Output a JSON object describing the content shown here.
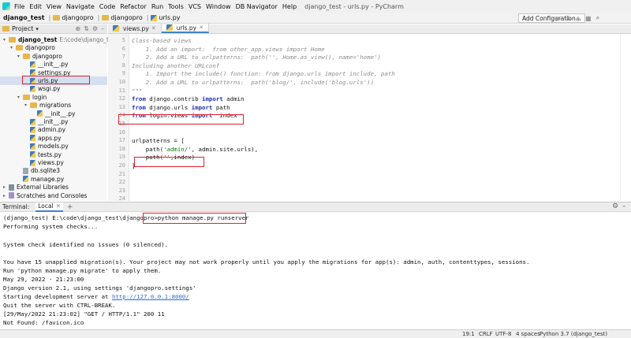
{
  "menu": {
    "items": [
      "File",
      "Edit",
      "View",
      "Navigate",
      "Code",
      "Refactor",
      "Run",
      "Tools",
      "VCS",
      "Window",
      "DB Navigator",
      "Help"
    ],
    "window_title": "django_test - urls.py - PyCharm"
  },
  "breadcrumb": {
    "root": "django_test",
    "folder": "djangopro",
    "file": "urls.py"
  },
  "toolbar": {
    "add_config_label": "Add Configuration...",
    "icons": [
      "run-icon",
      "debug-icon",
      "coverage-icon",
      "stop-icon",
      "search-icon"
    ]
  },
  "project_panel": {
    "title": "Project",
    "tree": [
      {
        "label": "django_test",
        "path": "E:\\code\\django_test",
        "depth": 0,
        "kind": "folder",
        "arrow": "▾",
        "bold": true
      },
      {
        "label": "djangopro",
        "depth": 1,
        "kind": "folder",
        "arrow": "▾"
      },
      {
        "label": "djangopro",
        "depth": 2,
        "kind": "folder",
        "arrow": "▾"
      },
      {
        "label": "__init__.py",
        "depth": 3,
        "kind": "py"
      },
      {
        "label": "settings.py",
        "depth": 3,
        "kind": "py"
      },
      {
        "label": "urls.py",
        "depth": 3,
        "kind": "py",
        "selected": true
      },
      {
        "label": "wsgi.py",
        "depth": 3,
        "kind": "py"
      },
      {
        "label": "login",
        "depth": 2,
        "kind": "folder",
        "arrow": "▾"
      },
      {
        "label": "migrations",
        "depth": 3,
        "kind": "folder",
        "arrow": "▾"
      },
      {
        "label": "__init__.py",
        "depth": 4,
        "kind": "py"
      },
      {
        "label": "__init__.py",
        "depth": 3,
        "kind": "py"
      },
      {
        "label": "admin.py",
        "depth": 3,
        "kind": "py"
      },
      {
        "label": "apps.py",
        "depth": 3,
        "kind": "py"
      },
      {
        "label": "models.py",
        "depth": 3,
        "kind": "py"
      },
      {
        "label": "tests.py",
        "depth": 3,
        "kind": "py"
      },
      {
        "label": "views.py",
        "depth": 3,
        "kind": "py"
      },
      {
        "label": "db.sqlite3",
        "depth": 2,
        "kind": "db"
      },
      {
        "label": "manage.py",
        "depth": 2,
        "kind": "py"
      },
      {
        "label": "External Libraries",
        "depth": 0,
        "kind": "lib",
        "arrow": "▸"
      },
      {
        "label": "Scratches and Consoles",
        "depth": 0,
        "kind": "scr",
        "arrow": "▸"
      }
    ]
  },
  "editor": {
    "tabs": [
      {
        "label": "views.py",
        "active": false
      },
      {
        "label": "urls.py",
        "active": true
      }
    ],
    "line_numbers": [
      "5",
      "6",
      "7",
      "8",
      "9",
      "10",
      "11",
      "12",
      "13",
      "14",
      "15",
      "16",
      "17",
      "18",
      "19",
      "20",
      "21",
      "22",
      "23",
      "24"
    ],
    "lines": [
      {
        "text": "Class-based views",
        "style": "comment"
      },
      {
        "text": "    1. Add an import:  from other_app.views import Home",
        "style": "comment"
      },
      {
        "text": "    2. Add a URL to urlpatterns:  path('', Home.as_view(), name='home')",
        "style": "comment"
      },
      {
        "text": "Including another URLconf",
        "style": "comment"
      },
      {
        "text": "    1. Import the include() function: from django.urls import include, path",
        "style": "comment"
      },
      {
        "text": "    2. Add a URL to urlpatterns:  path('blog/', include('blog.urls'))",
        "style": "comment"
      },
      {
        "text": "\"\"\"",
        "style": "doc"
      },
      {
        "text": "from django.contrib import admin",
        "style": "import"
      },
      {
        "text": "from django.urls import path",
        "style": "import"
      },
      {
        "text": "from login.views import  index",
        "style": "import"
      },
      {
        "text": "",
        "style": "plain"
      },
      {
        "text": "",
        "style": "plain"
      },
      {
        "text": "urlpatterns = [",
        "style": "plain"
      },
      {
        "text": "    path('admin/', admin.site.urls),",
        "style": "path"
      },
      {
        "text": "    path('',index)",
        "style": "path"
      },
      {
        "text": "]",
        "style": "plain"
      }
    ]
  },
  "terminal": {
    "label": "Terminal:",
    "tab_label": "Local",
    "prompt": "(django_test) E:\\code\\django_test\\djangopro",
    "command": ">python manage.py runserver",
    "lines": [
      "Performing system checks...",
      "",
      "System check identified no issues (0 silenced).",
      "",
      "You have 15 unapplied migration(s). Your project may not work properly until you apply the migrations for app(s): admin, auth, contenttypes, sessions.",
      "Run 'python manage.py migrate' to apply them.",
      "May 29, 2022 - 21:23:00",
      "Django version 2.1, using settings 'djangopro.settings'",
      "Quit the server with CTRL-BREAK.",
      "[29/May/2022 21:23:02] \"GET / HTTP/1.1\" 200 11",
      "Not Found: /favicon.ico"
    ],
    "server_line_prefix": "Starting development server at ",
    "server_url": "http://127.0.0.1:8000/"
  },
  "status_bar": {
    "position": "19:1",
    "line_sep": "CRLF",
    "encoding": "UTF-8",
    "indent": "4 spaces",
    "interpreter": "Python 3.7 (django_test)"
  }
}
